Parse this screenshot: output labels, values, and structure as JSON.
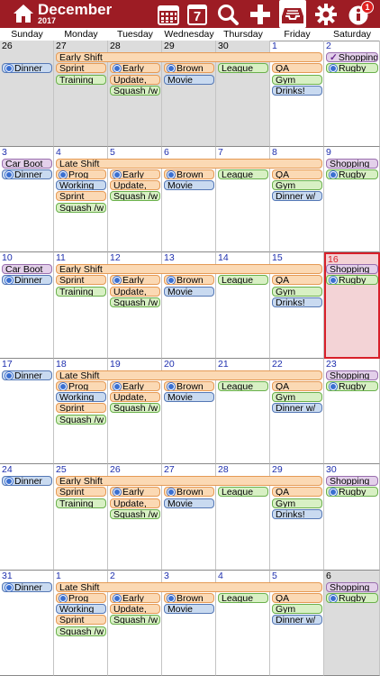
{
  "header": {
    "month": "December",
    "year": "2017",
    "calendar_day": "7",
    "info_badge": "1",
    "colors": {
      "bar": "#9d1c24",
      "today_border": "#d8202a"
    }
  },
  "weekdays": [
    "Sunday",
    "Monday",
    "Tuesday",
    "Wednesday",
    "Thursday",
    "Friday",
    "Saturday"
  ],
  "weeks": [
    {
      "days": [
        {
          "num": "26",
          "style": "gray"
        },
        {
          "num": "27",
          "style": "gray"
        },
        {
          "num": "28",
          "style": "gray"
        },
        {
          "num": "29",
          "style": "gray"
        },
        {
          "num": "30",
          "style": "gray"
        },
        {
          "num": "1",
          "style": "normal"
        },
        {
          "num": "2",
          "style": "normal"
        }
      ],
      "events": [
        {
          "text": "Dinner",
          "col": 0,
          "span": 1,
          "row": 1,
          "color": "blue",
          "icon": "repeat"
        },
        {
          "text": "Early Shift",
          "col": 1,
          "span": 5,
          "row": 0,
          "color": "orange"
        },
        {
          "text": "Shopping",
          "col": 6,
          "span": 1,
          "row": 0,
          "color": "purple",
          "icon": "check"
        },
        {
          "text": "Sprint",
          "col": 1,
          "span": 1,
          "row": 1,
          "color": "orange"
        },
        {
          "text": "Early",
          "col": 2,
          "span": 1,
          "row": 1,
          "color": "orange",
          "icon": "repeat"
        },
        {
          "text": "Brown",
          "col": 3,
          "span": 1,
          "row": 1,
          "color": "orange",
          "icon": "repeat"
        },
        {
          "text": "League",
          "col": 4,
          "span": 1,
          "row": 1,
          "color": "green"
        },
        {
          "text": "QA",
          "col": 5,
          "span": 1,
          "row": 1,
          "color": "orange"
        },
        {
          "text": "Rugby",
          "col": 6,
          "span": 1,
          "row": 1,
          "color": "green",
          "icon": "repeat"
        },
        {
          "text": "Training",
          "col": 1,
          "span": 1,
          "row": 2,
          "color": "green"
        },
        {
          "text": "Update,",
          "col": 2,
          "span": 1,
          "row": 2,
          "color": "orange"
        },
        {
          "text": "Movie",
          "col": 3,
          "span": 1,
          "row": 2,
          "color": "blue"
        },
        {
          "text": "Gym",
          "col": 5,
          "span": 1,
          "row": 2,
          "color": "green"
        },
        {
          "text": "Squash /w",
          "col": 2,
          "span": 1,
          "row": 3,
          "color": "green"
        },
        {
          "text": "Drinks!",
          "col": 5,
          "span": 1,
          "row": 3,
          "color": "blue"
        }
      ]
    },
    {
      "days": [
        {
          "num": "3",
          "style": "normal"
        },
        {
          "num": "4",
          "style": "normal"
        },
        {
          "num": "5",
          "style": "normal"
        },
        {
          "num": "6",
          "style": "normal"
        },
        {
          "num": "7",
          "style": "normal"
        },
        {
          "num": "8",
          "style": "normal"
        },
        {
          "num": "9",
          "style": "normal"
        }
      ],
      "events": [
        {
          "text": "Car Boot",
          "col": 0,
          "span": 1,
          "row": 0,
          "color": "purple"
        },
        {
          "text": "Late Shift",
          "col": 1,
          "span": 5,
          "row": 0,
          "color": "orange"
        },
        {
          "text": "Shopping",
          "col": 6,
          "span": 1,
          "row": 0,
          "color": "purple"
        },
        {
          "text": "Dinner",
          "col": 0,
          "span": 1,
          "row": 1,
          "color": "blue",
          "icon": "repeat"
        },
        {
          "text": "Prog",
          "col": 1,
          "span": 1,
          "row": 1,
          "color": "orange",
          "icon": "repeat"
        },
        {
          "text": "Early",
          "col": 2,
          "span": 1,
          "row": 1,
          "color": "orange",
          "icon": "repeat"
        },
        {
          "text": "Brown",
          "col": 3,
          "span": 1,
          "row": 1,
          "color": "orange",
          "icon": "repeat"
        },
        {
          "text": "League",
          "col": 4,
          "span": 1,
          "row": 1,
          "color": "green"
        },
        {
          "text": "QA",
          "col": 5,
          "span": 1,
          "row": 1,
          "color": "orange"
        },
        {
          "text": "Rugby",
          "col": 6,
          "span": 1,
          "row": 1,
          "color": "green",
          "icon": "repeat"
        },
        {
          "text": "Working",
          "col": 1,
          "span": 1,
          "row": 2,
          "color": "blue"
        },
        {
          "text": "Update,",
          "col": 2,
          "span": 1,
          "row": 2,
          "color": "orange"
        },
        {
          "text": "Movie",
          "col": 3,
          "span": 1,
          "row": 2,
          "color": "blue"
        },
        {
          "text": "Gym",
          "col": 5,
          "span": 1,
          "row": 2,
          "color": "green"
        },
        {
          "text": "Sprint",
          "col": 1,
          "span": 1,
          "row": 3,
          "color": "orange"
        },
        {
          "text": "Squash /w",
          "col": 2,
          "span": 1,
          "row": 3,
          "color": "green"
        },
        {
          "text": "Dinner w/",
          "col": 5,
          "span": 1,
          "row": 3,
          "color": "blue"
        },
        {
          "text": "Squash /w",
          "col": 1,
          "span": 1,
          "row": 4,
          "color": "green"
        }
      ]
    },
    {
      "days": [
        {
          "num": "10",
          "style": "normal"
        },
        {
          "num": "11",
          "style": "normal"
        },
        {
          "num": "12",
          "style": "normal"
        },
        {
          "num": "13",
          "style": "normal"
        },
        {
          "num": "14",
          "style": "normal"
        },
        {
          "num": "15",
          "style": "normal"
        },
        {
          "num": "16",
          "style": "today"
        }
      ],
      "events": [
        {
          "text": "Car Boot",
          "col": 0,
          "span": 1,
          "row": 0,
          "color": "purple"
        },
        {
          "text": "Early Shift",
          "col": 1,
          "span": 5,
          "row": 0,
          "color": "orange"
        },
        {
          "text": "Shopping",
          "col": 6,
          "span": 1,
          "row": 0,
          "color": "purple"
        },
        {
          "text": "Dinner",
          "col": 0,
          "span": 1,
          "row": 1,
          "color": "blue",
          "icon": "repeat"
        },
        {
          "text": "Sprint",
          "col": 1,
          "span": 1,
          "row": 1,
          "color": "orange"
        },
        {
          "text": "Early",
          "col": 2,
          "span": 1,
          "row": 1,
          "color": "orange",
          "icon": "repeat"
        },
        {
          "text": "Brown",
          "col": 3,
          "span": 1,
          "row": 1,
          "color": "orange",
          "icon": "repeat"
        },
        {
          "text": "League",
          "col": 4,
          "span": 1,
          "row": 1,
          "color": "green"
        },
        {
          "text": "QA",
          "col": 5,
          "span": 1,
          "row": 1,
          "color": "orange"
        },
        {
          "text": "Rugby",
          "col": 6,
          "span": 1,
          "row": 1,
          "color": "green",
          "icon": "repeat"
        },
        {
          "text": "Training",
          "col": 1,
          "span": 1,
          "row": 2,
          "color": "green"
        },
        {
          "text": "Update,",
          "col": 2,
          "span": 1,
          "row": 2,
          "color": "orange"
        },
        {
          "text": "Movie",
          "col": 3,
          "span": 1,
          "row": 2,
          "color": "blue"
        },
        {
          "text": "Gym",
          "col": 5,
          "span": 1,
          "row": 2,
          "color": "green"
        },
        {
          "text": "Squash /w",
          "col": 2,
          "span": 1,
          "row": 3,
          "color": "green"
        },
        {
          "text": "Drinks!",
          "col": 5,
          "span": 1,
          "row": 3,
          "color": "blue"
        }
      ]
    },
    {
      "days": [
        {
          "num": "17",
          "style": "normal"
        },
        {
          "num": "18",
          "style": "normal"
        },
        {
          "num": "19",
          "style": "normal"
        },
        {
          "num": "20",
          "style": "normal"
        },
        {
          "num": "21",
          "style": "normal"
        },
        {
          "num": "22",
          "style": "normal"
        },
        {
          "num": "23",
          "style": "normal"
        }
      ],
      "events": [
        {
          "text": "Dinner",
          "col": 0,
          "span": 1,
          "row": 0,
          "color": "blue",
          "icon": "repeat"
        },
        {
          "text": "Late Shift",
          "col": 1,
          "span": 5,
          "row": 0,
          "color": "orange"
        },
        {
          "text": "Shopping",
          "col": 6,
          "span": 1,
          "row": 0,
          "color": "purple"
        },
        {
          "text": "Prog",
          "col": 1,
          "span": 1,
          "row": 1,
          "color": "orange",
          "icon": "repeat"
        },
        {
          "text": "Early",
          "col": 2,
          "span": 1,
          "row": 1,
          "color": "orange",
          "icon": "repeat"
        },
        {
          "text": "Brown",
          "col": 3,
          "span": 1,
          "row": 1,
          "color": "orange",
          "icon": "repeat"
        },
        {
          "text": "League",
          "col": 4,
          "span": 1,
          "row": 1,
          "color": "green"
        },
        {
          "text": "QA",
          "col": 5,
          "span": 1,
          "row": 1,
          "color": "orange"
        },
        {
          "text": "Rugby",
          "col": 6,
          "span": 1,
          "row": 1,
          "color": "green",
          "icon": "repeat"
        },
        {
          "text": "Working",
          "col": 1,
          "span": 1,
          "row": 2,
          "color": "blue"
        },
        {
          "text": "Update,",
          "col": 2,
          "span": 1,
          "row": 2,
          "color": "orange"
        },
        {
          "text": "Movie",
          "col": 3,
          "span": 1,
          "row": 2,
          "color": "blue"
        },
        {
          "text": "Gym",
          "col": 5,
          "span": 1,
          "row": 2,
          "color": "green"
        },
        {
          "text": "Sprint",
          "col": 1,
          "span": 1,
          "row": 3,
          "color": "orange"
        },
        {
          "text": "Squash /w",
          "col": 2,
          "span": 1,
          "row": 3,
          "color": "green"
        },
        {
          "text": "Dinner w/",
          "col": 5,
          "span": 1,
          "row": 3,
          "color": "blue"
        },
        {
          "text": "Squash /w",
          "col": 1,
          "span": 1,
          "row": 4,
          "color": "green"
        }
      ]
    },
    {
      "days": [
        {
          "num": "24",
          "style": "normal"
        },
        {
          "num": "25",
          "style": "normal"
        },
        {
          "num": "26",
          "style": "normal"
        },
        {
          "num": "27",
          "style": "normal"
        },
        {
          "num": "28",
          "style": "normal"
        },
        {
          "num": "29",
          "style": "normal"
        },
        {
          "num": "30",
          "style": "normal"
        }
      ],
      "events": [
        {
          "text": "Dinner",
          "col": 0,
          "span": 1,
          "row": 0,
          "color": "blue",
          "icon": "repeat"
        },
        {
          "text": "Early Shift",
          "col": 1,
          "span": 5,
          "row": 0,
          "color": "orange"
        },
        {
          "text": "Shopping",
          "col": 6,
          "span": 1,
          "row": 0,
          "color": "purple"
        },
        {
          "text": "Sprint",
          "col": 1,
          "span": 1,
          "row": 1,
          "color": "orange"
        },
        {
          "text": "Early",
          "col": 2,
          "span": 1,
          "row": 1,
          "color": "orange",
          "icon": "repeat"
        },
        {
          "text": "Brown",
          "col": 3,
          "span": 1,
          "row": 1,
          "color": "orange",
          "icon": "repeat"
        },
        {
          "text": "League",
          "col": 4,
          "span": 1,
          "row": 1,
          "color": "green"
        },
        {
          "text": "QA",
          "col": 5,
          "span": 1,
          "row": 1,
          "color": "orange"
        },
        {
          "text": "Rugby",
          "col": 6,
          "span": 1,
          "row": 1,
          "color": "green",
          "icon": "repeat"
        },
        {
          "text": "Training",
          "col": 1,
          "span": 1,
          "row": 2,
          "color": "green"
        },
        {
          "text": "Update,",
          "col": 2,
          "span": 1,
          "row": 2,
          "color": "orange"
        },
        {
          "text": "Movie",
          "col": 3,
          "span": 1,
          "row": 2,
          "color": "blue"
        },
        {
          "text": "Gym",
          "col": 5,
          "span": 1,
          "row": 2,
          "color": "green"
        },
        {
          "text": "Squash /w",
          "col": 2,
          "span": 1,
          "row": 3,
          "color": "green"
        },
        {
          "text": "Drinks!",
          "col": 5,
          "span": 1,
          "row": 3,
          "color": "blue"
        }
      ]
    },
    {
      "days": [
        {
          "num": "31",
          "style": "normal"
        },
        {
          "num": "1",
          "style": "normal"
        },
        {
          "num": "2",
          "style": "normal"
        },
        {
          "num": "3",
          "style": "normal"
        },
        {
          "num": "4",
          "style": "normal"
        },
        {
          "num": "5",
          "style": "normal"
        },
        {
          "num": "6",
          "style": "gray"
        }
      ],
      "events": [
        {
          "text": "Dinner",
          "col": 0,
          "span": 1,
          "row": 0,
          "color": "blue",
          "icon": "repeat"
        },
        {
          "text": "Late Shift",
          "col": 1,
          "span": 5,
          "row": 0,
          "color": "orange"
        },
        {
          "text": "Shopping",
          "col": 6,
          "span": 1,
          "row": 0,
          "color": "purple"
        },
        {
          "text": "Prog",
          "col": 1,
          "span": 1,
          "row": 1,
          "color": "orange",
          "icon": "repeat"
        },
        {
          "text": "Early",
          "col": 2,
          "span": 1,
          "row": 1,
          "color": "orange",
          "icon": "repeat"
        },
        {
          "text": "Brown",
          "col": 3,
          "span": 1,
          "row": 1,
          "color": "orange",
          "icon": "repeat"
        },
        {
          "text": "League",
          "col": 4,
          "span": 1,
          "row": 1,
          "color": "green"
        },
        {
          "text": "QA",
          "col": 5,
          "span": 1,
          "row": 1,
          "color": "orange"
        },
        {
          "text": "Rugby",
          "col": 6,
          "span": 1,
          "row": 1,
          "color": "green",
          "icon": "repeat"
        },
        {
          "text": "Working",
          "col": 1,
          "span": 1,
          "row": 2,
          "color": "blue"
        },
        {
          "text": "Update,",
          "col": 2,
          "span": 1,
          "row": 2,
          "color": "orange"
        },
        {
          "text": "Movie",
          "col": 3,
          "span": 1,
          "row": 2,
          "color": "blue"
        },
        {
          "text": "Gym",
          "col": 5,
          "span": 1,
          "row": 2,
          "color": "green"
        },
        {
          "text": "Sprint",
          "col": 1,
          "span": 1,
          "row": 3,
          "color": "orange"
        },
        {
          "text": "Squash /w",
          "col": 2,
          "span": 1,
          "row": 3,
          "color": "green"
        },
        {
          "text": "Dinner w/",
          "col": 5,
          "span": 1,
          "row": 3,
          "color": "blue"
        },
        {
          "text": "Squash /w",
          "col": 1,
          "span": 1,
          "row": 4,
          "color": "green"
        }
      ]
    }
  ]
}
